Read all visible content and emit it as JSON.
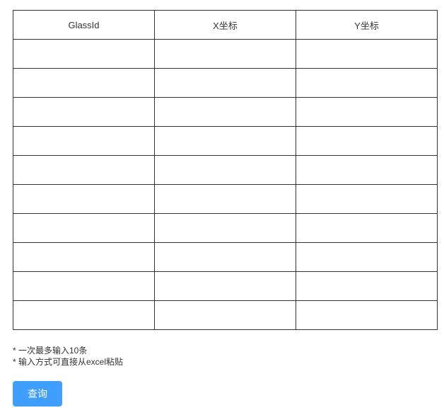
{
  "table": {
    "headers": [
      "GlassId",
      "X坐标",
      "Y坐标"
    ],
    "rows": [
      [
        "",
        "",
        ""
      ],
      [
        "",
        "",
        ""
      ],
      [
        "",
        "",
        ""
      ],
      [
        "",
        "",
        ""
      ],
      [
        "",
        "",
        ""
      ],
      [
        "",
        "",
        ""
      ],
      [
        "",
        "",
        ""
      ],
      [
        "",
        "",
        ""
      ],
      [
        "",
        "",
        ""
      ],
      [
        "",
        "",
        ""
      ]
    ]
  },
  "notes": [
    "* 一次最多输入10条",
    "* 输入方式可直接从excel粘贴"
  ],
  "actions": {
    "query_label": "查询"
  },
  "colors": {
    "primary_button": "#409eff",
    "border": "#333333",
    "text": "#333333"
  }
}
